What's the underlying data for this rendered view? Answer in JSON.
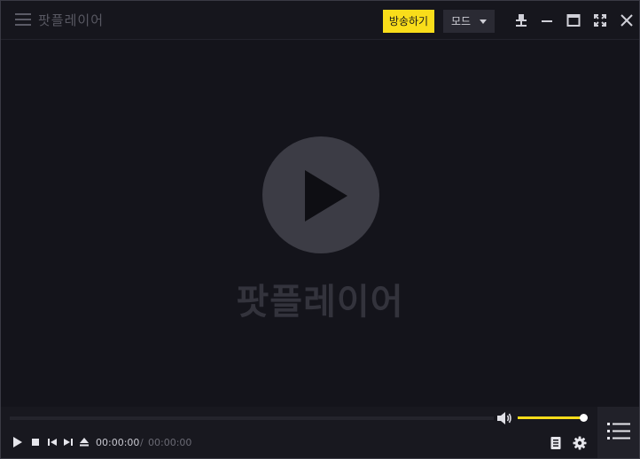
{
  "window": {
    "title": "팟플레이어",
    "broadcast_label": "방송하기",
    "mode_label": "모드"
  },
  "video": {
    "logo_text": "팟플레이어"
  },
  "player": {
    "current_time": "00:00:00",
    "separator": "/",
    "total_time": "00:00:00",
    "progress": 0,
    "volume": 1.0
  },
  "colors": {
    "accent": "#f9dd1a",
    "background": "#14141b"
  },
  "icons": {
    "menu": "hamburger-menu-icon",
    "pin": "pin-icon",
    "minimize": "minimize-icon",
    "maximize": "maximize-icon",
    "fullscreen": "fullscreen-icon",
    "close": "close-icon",
    "play": "play-icon",
    "stop": "stop-icon",
    "previous": "skip-previous-icon",
    "next": "skip-next-icon",
    "eject": "eject-icon",
    "volume": "volume-icon",
    "chapter": "chapter-list-icon",
    "settings": "gear-icon",
    "playlist": "playlist-icon"
  }
}
